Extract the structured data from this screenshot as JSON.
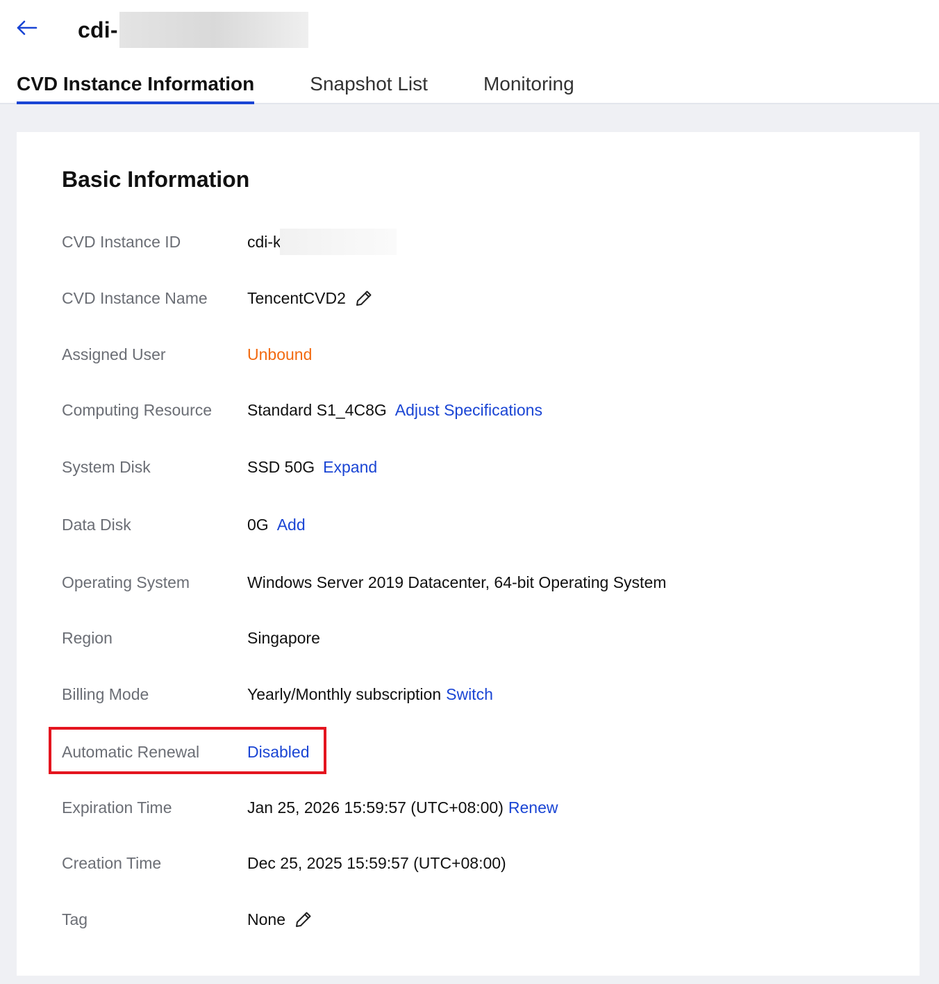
{
  "header": {
    "title": "cdi-",
    "back_icon": "arrow-left-icon"
  },
  "tabs": [
    {
      "label": "CVD Instance Information",
      "active": true
    },
    {
      "label": "Snapshot List",
      "active": false
    },
    {
      "label": "Monitoring",
      "active": false
    }
  ],
  "section_title": "Basic Information",
  "fields": {
    "instance_id": {
      "label": "CVD Instance ID",
      "value": "cdi-k"
    },
    "instance_name": {
      "label": "CVD Instance Name",
      "value": "TencentCVD2"
    },
    "assigned_user": {
      "label": "Assigned User",
      "value": "Unbound"
    },
    "computing_resource": {
      "label": "Computing Resource",
      "value": "Standard S1_4C8G",
      "action": "Adjust Specifications"
    },
    "system_disk": {
      "label": "System Disk",
      "value": "SSD 50G",
      "action": "Expand"
    },
    "data_disk": {
      "label": "Data Disk",
      "value": "0G",
      "action": "Add"
    },
    "operating_system": {
      "label": "Operating System",
      "value": "Windows Server 2019 Datacenter, 64-bit Operating System"
    },
    "region": {
      "label": "Region",
      "value": "Singapore"
    },
    "billing_mode": {
      "label": "Billing Mode",
      "value": "Yearly/Monthly subscription",
      "action": "Switch"
    },
    "automatic_renewal": {
      "label": "Automatic Renewal",
      "value": "Disabled"
    },
    "expiration_time": {
      "label": "Expiration Time",
      "value": "Jan 25, 2026 15:59:57 (UTC+08:00)",
      "action": "Renew"
    },
    "creation_time": {
      "label": "Creation Time",
      "value": "Dec 25, 2025 15:59:57 (UTC+08:00)"
    },
    "tag": {
      "label": "Tag",
      "value": "None"
    }
  },
  "colors": {
    "accent": "#1a45d4",
    "warning": "#f26a10",
    "highlight": "#e4151f",
    "label": "#6b6e75",
    "background": "#eff0f4"
  }
}
